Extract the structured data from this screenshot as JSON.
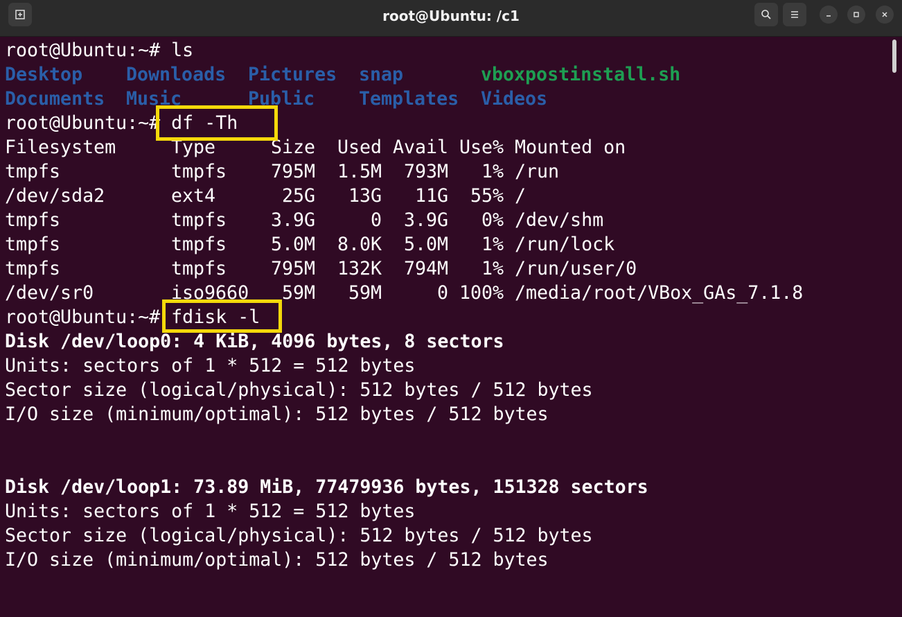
{
  "window": {
    "title": "root@Ubuntu: /c1",
    "buttons": {
      "new_tab_icon": "new-tab-icon",
      "search_icon": "search-icon",
      "menu_icon": "hamburger-menu-icon",
      "minimize_icon": "minimize-icon",
      "maximize_icon": "maximize-icon",
      "close_icon": "close-icon"
    }
  },
  "colors": {
    "terminal_bg": "#300a24",
    "directory": "#2a5ea8",
    "executable": "#1e9e52",
    "highlight_box": "#f5d90a"
  },
  "terminal": {
    "prompt": "root@Ubuntu:~#",
    "cmd_ls": " ls",
    "ls_row1": [
      "Desktop",
      "Downloads",
      "Pictures",
      "snap",
      "vboxpostinstall.sh"
    ],
    "ls_row2": [
      "Documents",
      "Music",
      "Public",
      "Templates",
      "Videos"
    ],
    "cmd_df": " df -Th",
    "df_headers": [
      "Filesystem",
      "Type",
      "Size",
      "Used",
      "Avail",
      "Use%",
      "Mounted on"
    ],
    "df_rows": [
      [
        "tmpfs",
        "tmpfs",
        "795M",
        "1.5M",
        "793M",
        "1%",
        "/run"
      ],
      [
        "/dev/sda2",
        "ext4",
        "25G",
        "13G",
        "11G",
        "55%",
        "/"
      ],
      [
        "tmpfs",
        "tmpfs",
        "3.9G",
        "0",
        "3.9G",
        "0%",
        "/dev/shm"
      ],
      [
        "tmpfs",
        "tmpfs",
        "5.0M",
        "8.0K",
        "5.0M",
        "1%",
        "/run/lock"
      ],
      [
        "tmpfs",
        "tmpfs",
        "795M",
        "132K",
        "794M",
        "1%",
        "/run/user/0"
      ],
      [
        "/dev/sr0",
        "iso9660",
        "59M",
        "59M",
        "0",
        "100%",
        "/media/root/VBox_GAs_7.1.8"
      ]
    ],
    "cmd_fdisk": " fdisk -l",
    "disk0": {
      "header": "Disk /dev/loop0: 4 KiB, 4096 bytes, 8 sectors",
      "units": "Units: sectors of 1 * 512 = 512 bytes",
      "sector": "Sector size (logical/physical): 512 bytes / 512 bytes",
      "io": "I/O size (minimum/optimal): 512 bytes / 512 bytes"
    },
    "disk1": {
      "header": "Disk /dev/loop1: 73.89 MiB, 77479936 bytes, 151328 sectors",
      "units": "Units: sectors of 1 * 512 = 512 bytes",
      "sector": "Sector size (logical/physical): 512 bytes / 512 bytes",
      "io": "I/O size (minimum/optimal): 512 bytes / 512 bytes"
    }
  }
}
